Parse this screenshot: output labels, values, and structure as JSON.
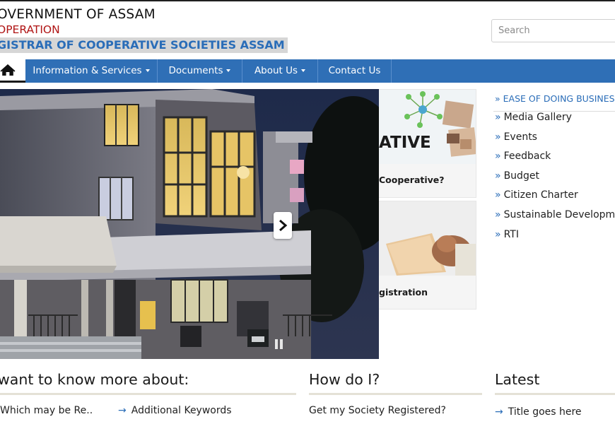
{
  "header": {
    "gov_title": "OVERNMENT OF ASSAM",
    "department": "OPERATION",
    "office": "GISTRAR OF COOPERATIVE SOCIETIES ASSAM",
    "search_placeholder": "Search"
  },
  "nav": {
    "home_icon": "home-icon",
    "items": [
      {
        "label": "Information & Services",
        "dropdown": true
      },
      {
        "label": "Documents",
        "dropdown": true
      },
      {
        "label": "About Us",
        "dropdown": true
      },
      {
        "label": "Contact Us",
        "dropdown": false
      }
    ]
  },
  "cards": [
    {
      "image_text": "ATIVE",
      "label": "Cooperative?"
    },
    {
      "label": "gistration"
    }
  ],
  "quick_links": [
    "EASE OF DOING BUSINESS",
    "Media Gallery",
    "Events",
    "Feedback",
    "Budget",
    "Citizen Charter",
    "Sustainable Developmen",
    "RTI"
  ],
  "sections": {
    "know_more": {
      "title": "want to know more about:",
      "links": [
        "Which may be Re..",
        "Additional Keywords"
      ]
    },
    "how_do_i": {
      "title": "How do I?",
      "links": [
        "Get my Society Registered?"
      ]
    },
    "latest": {
      "title": "Latest",
      "links": [
        "Title goes here"
      ]
    }
  },
  "colors": {
    "nav_bg": "#2f6fb6",
    "accent_blue": "#2a6db8",
    "dept_red": "#b01515"
  }
}
